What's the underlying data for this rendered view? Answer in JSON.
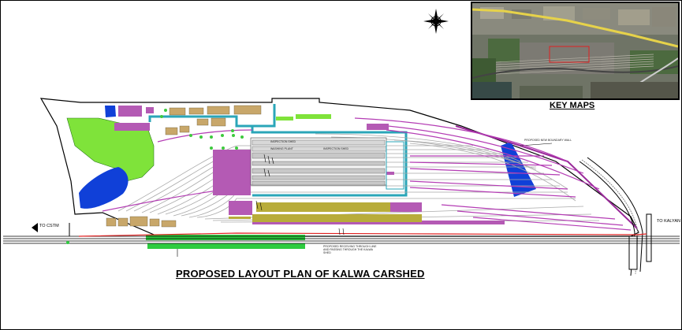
{
  "title": "PROPOSED LAYOUT PLAN OF KALWA CARSHED",
  "key_map": {
    "label": "KEY MAPS"
  },
  "directions": {
    "west": "TO CSTM",
    "east": "TO KALYAN"
  },
  "annotations": {
    "boundary_wall": "PROPOSED NEW BOUNDARY WALL",
    "track_note": "PROPOSED RECEIVING THROUGH LINE AND PASSING THROUGH THE KALWA SHED",
    "building_1": "INSPECTION SHED",
    "building_2": "WASHING PLANT",
    "building_3": "INSPECTION SHED"
  },
  "colors": {
    "track_gray": "#a9a9a9",
    "track_magenta": "#b43cb4",
    "building_purple": "#b45ab4",
    "green_area": "#7fe33a",
    "water_blue": "#1040d8",
    "teal_road": "#2aa6b8",
    "olive_platform": "#b8ac3a",
    "tan_building": "#c8a76a",
    "main_line_red": "#e02020"
  },
  "icons": {
    "north_arrow": "compass-rose-icon",
    "arrow_west": "arrow-left-icon"
  }
}
